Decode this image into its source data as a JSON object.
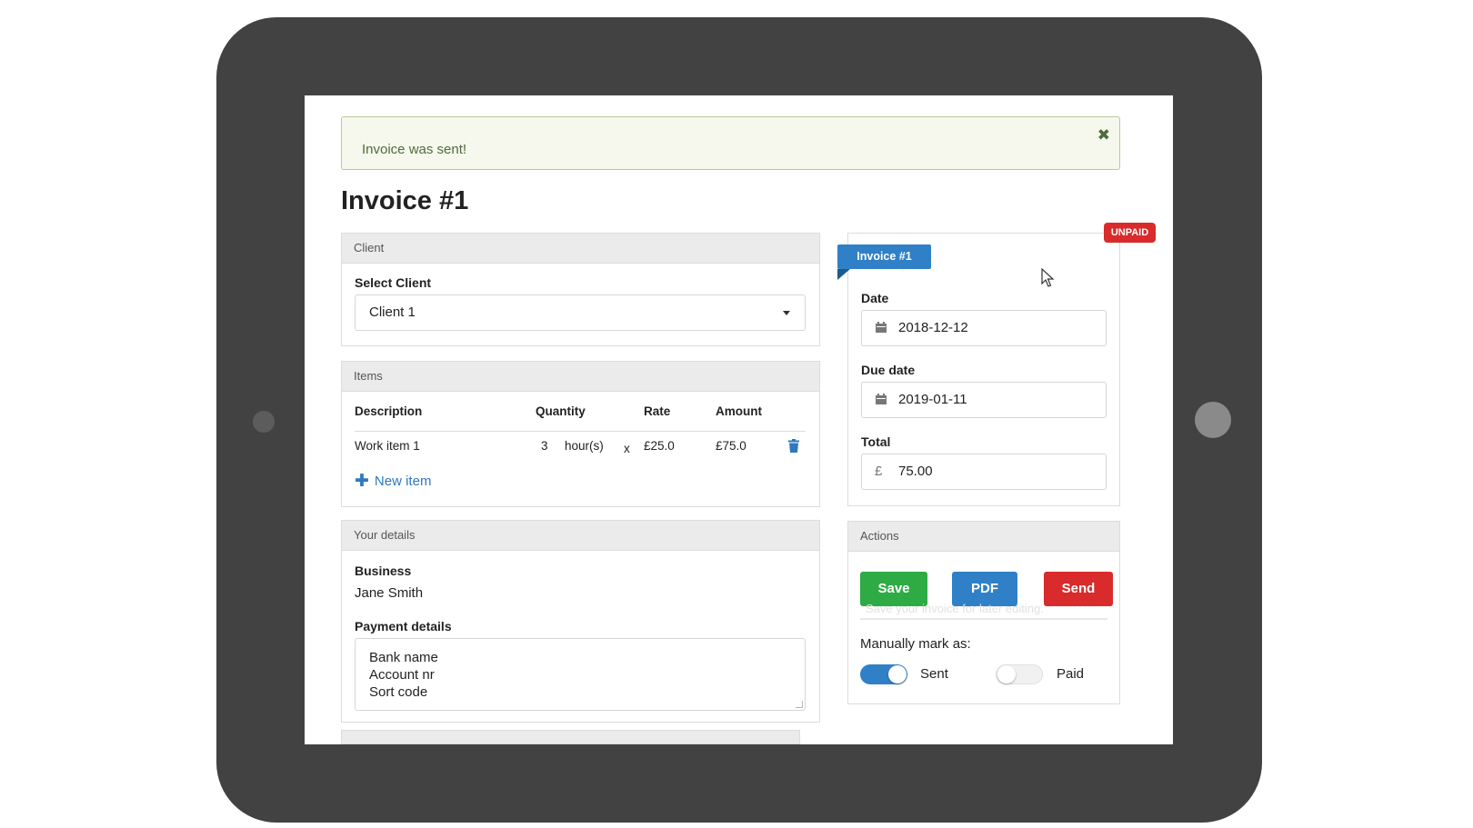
{
  "alert": {
    "message": "Invoice was sent!",
    "close_glyph": "✖"
  },
  "page": {
    "title": "Invoice #1"
  },
  "client_panel": {
    "header": "Client",
    "select_label": "Select Client",
    "selected_client": "Client 1"
  },
  "items_panel": {
    "header": "Items",
    "columns": {
      "description": "Description",
      "quantity": "Quantity",
      "rate": "Rate",
      "amount": "Amount"
    },
    "rows": [
      {
        "description": "Work item 1",
        "quantity": "3",
        "unit": "hour(s)",
        "times": "x",
        "rate": "£25.0",
        "amount": "£75.0"
      }
    ],
    "new_item_label": "New item"
  },
  "details_panel": {
    "header": "Your details",
    "business_label": "Business",
    "business_value": "Jane Smith",
    "payment_label": "Payment details",
    "payment_lines": [
      "Bank name",
      "Account nr",
      "Sort code"
    ]
  },
  "invoice_card": {
    "ribbon": "Invoice #1",
    "status_badge": "UNPAID",
    "date_label": "Date",
    "date_value": "2018-12-12",
    "due_label": "Due date",
    "due_value": "2019-01-11",
    "total_label": "Total",
    "currency_symbol": "£",
    "total_value": "75.00"
  },
  "actions_panel": {
    "header": "Actions",
    "save_label": "Save",
    "pdf_label": "PDF",
    "send_label": "Send",
    "tooltip": "Save your invoice for later editing.",
    "manual_label": "Manually mark as:",
    "sent_label": "Sent",
    "paid_label": "Paid",
    "sent_on": true,
    "paid_on": false
  },
  "colors": {
    "save": "#2eab45",
    "pdf": "#2f80c7",
    "send": "#d92b2b",
    "toggle_on": "#2f80c7",
    "link": "#2f78c0",
    "tablet_frame": "#424242"
  },
  "icons": [
    "close-icon",
    "chevron-down-icon",
    "trash-icon",
    "plus-icon",
    "calendar-icon",
    "pound-icon",
    "mouse-cursor-icon"
  ]
}
